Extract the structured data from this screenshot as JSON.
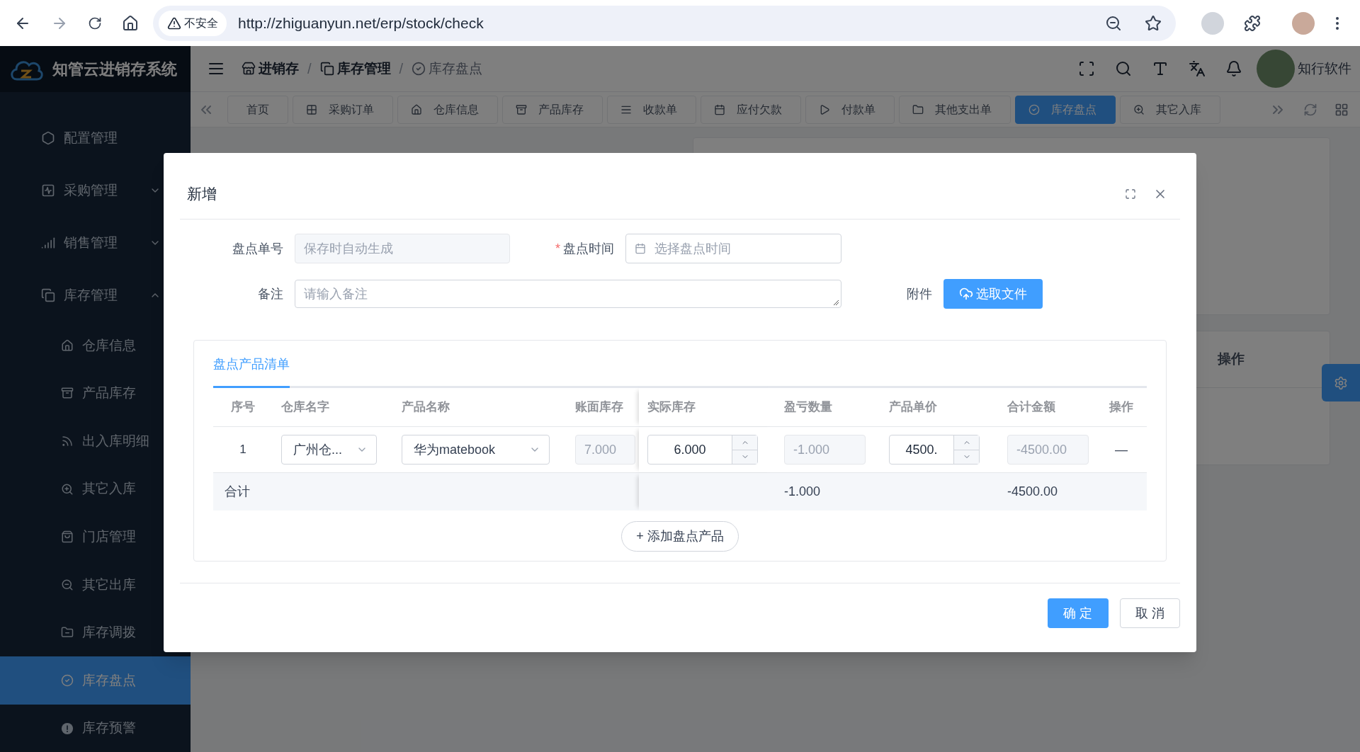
{
  "browser": {
    "security_label": "不安全",
    "url": "http://zhiguanyun.net/erp/stock/check"
  },
  "app": {
    "logo_text": "知管云进销存系统",
    "breadcrumb": [
      {
        "label": "进销存",
        "current": false
      },
      {
        "separator": "/",
        "label": "库存管理",
        "current": false
      },
      {
        "separator": "/",
        "label": "库存盘点",
        "current": true
      }
    ],
    "user_name": "知行软件"
  },
  "tabs": [
    {
      "label": "首页",
      "selected": false
    },
    {
      "label": "采购订单",
      "selected": false
    },
    {
      "label": "仓库信息",
      "selected": false
    },
    {
      "label": "产品库存",
      "selected": false
    },
    {
      "label": "收款单",
      "selected": false
    },
    {
      "label": "应付欠款",
      "selected": false
    },
    {
      "label": "付款单",
      "selected": false
    },
    {
      "label": "其他支出单",
      "selected": false
    },
    {
      "label": "库存盘点",
      "selected": true
    },
    {
      "label": "其它入库",
      "selected": false
    }
  ],
  "sidebar": {
    "items": [
      {
        "label": "配置管理",
        "kind": "link",
        "selected": false
      },
      {
        "label": "采购管理",
        "kind": "group",
        "expanded": false,
        "selected": false
      },
      {
        "label": "销售管理",
        "kind": "group",
        "expanded": false,
        "selected": false
      },
      {
        "label": "库存管理",
        "kind": "group",
        "expanded": true,
        "selected": false,
        "children": [
          {
            "label": "仓库信息",
            "selected": false
          },
          {
            "label": "产品库存",
            "selected": false
          },
          {
            "label": "出入库明细",
            "selected": false
          },
          {
            "label": "其它入库",
            "selected": false
          },
          {
            "label": "门店管理",
            "selected": false
          },
          {
            "label": "其它出库",
            "selected": false
          },
          {
            "label": "库存调拨",
            "selected": false
          },
          {
            "label": "库存盘点",
            "selected": true
          },
          {
            "label": "库存预警",
            "selected": false
          }
        ]
      }
    ]
  },
  "background": {
    "column_header": "操作"
  },
  "dialog": {
    "title": "新增",
    "fields": {
      "order_no": {
        "label": "盘点单号",
        "placeholder": "保存时自动生成",
        "disabled": true
      },
      "check_time": {
        "label": "盘点时间",
        "required": true,
        "required_mark": "*",
        "placeholder": "选择盘点时间"
      },
      "note": {
        "label": "备注",
        "placeholder": "请输入备注"
      },
      "attachment": {
        "label": "附件",
        "button": "选取文件"
      }
    },
    "list_tab": {
      "label": "盘点产品清单",
      "selected": true
    },
    "table": {
      "columns": [
        {
          "label": "序号",
          "kind": "index"
        },
        {
          "label": "仓库名字",
          "kind": "select"
        },
        {
          "label": "产品名称",
          "kind": "select"
        },
        {
          "label": "账面库存",
          "kind": "readonly"
        },
        {
          "label": "实际库存",
          "kind": "number"
        },
        {
          "label": "盈亏数量",
          "kind": "readonly",
          "total": "-1.000"
        },
        {
          "label": "产品单价",
          "kind": "number"
        },
        {
          "label": "合计金额",
          "kind": "readonly",
          "total": "-4500.00"
        },
        {
          "label": "操作",
          "kind": "action"
        }
      ],
      "rows": [
        {
          "cells": [
            "1",
            "广州仓...",
            "华为matebook",
            "7.000",
            "6.000",
            "-1.000",
            "4500.",
            "-4500.00",
            "—"
          ]
        }
      ],
      "total_label": "合计"
    },
    "add_button": "+ 添加盘点产品",
    "buttons": {
      "confirm": "确 定",
      "cancel": "取 消"
    }
  }
}
